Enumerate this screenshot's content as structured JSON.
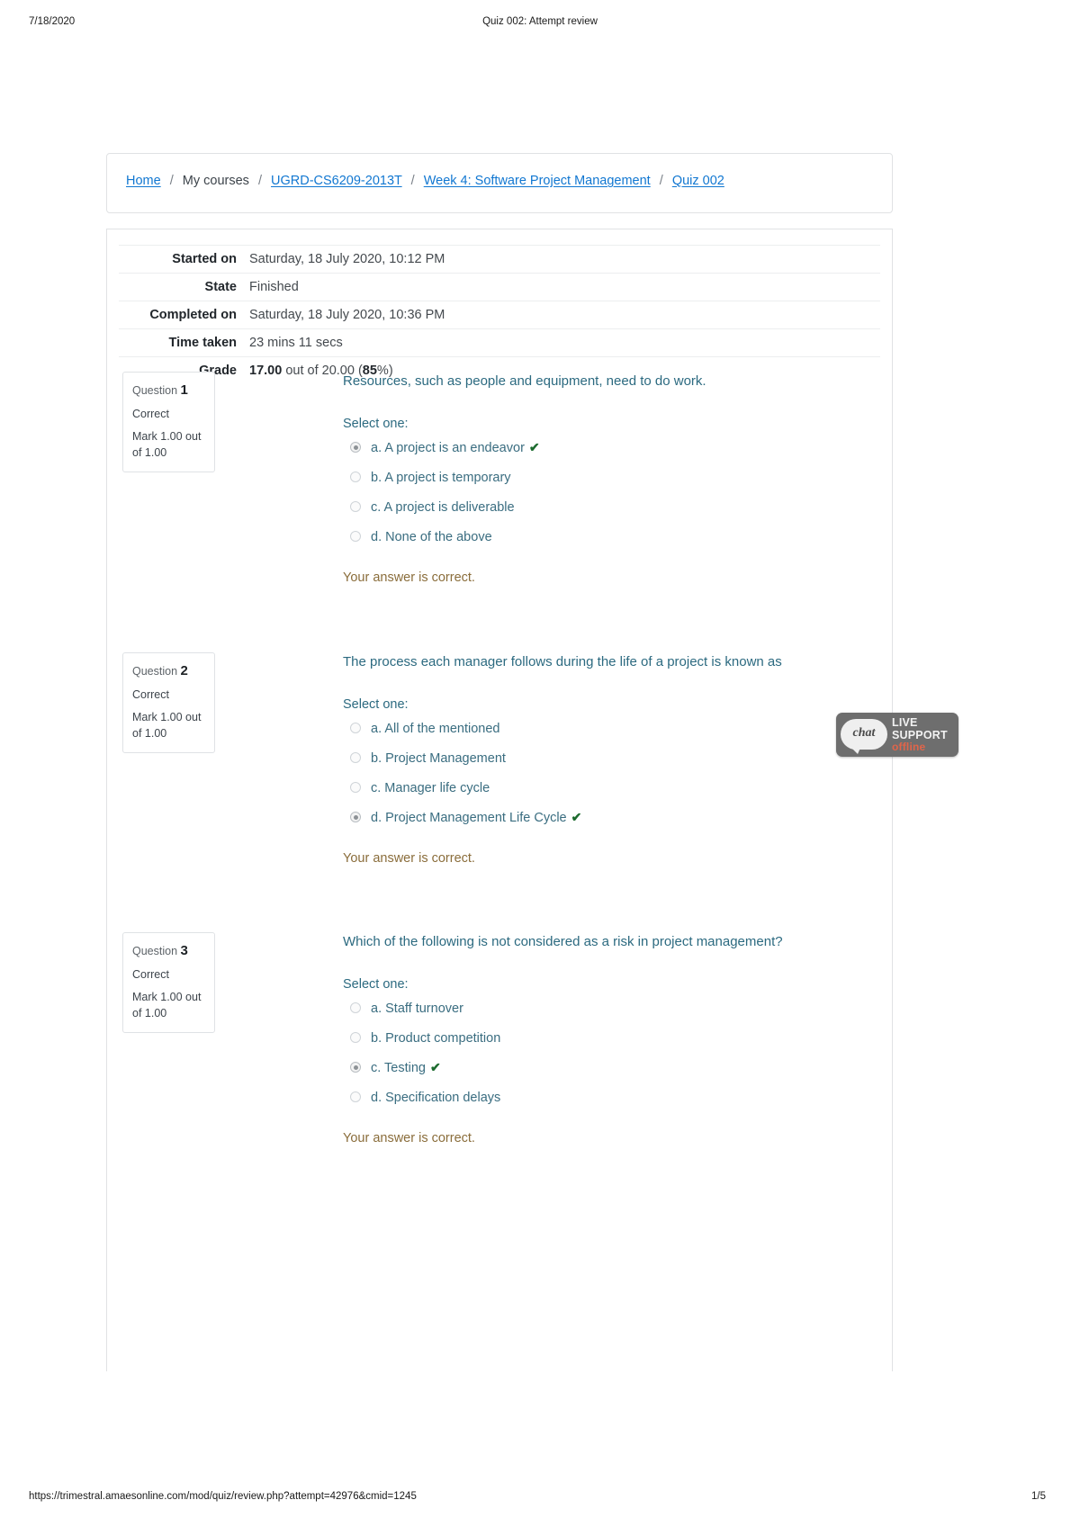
{
  "print": {
    "date": "7/18/2020",
    "title": "Quiz 002: Attempt review",
    "url": "https://trimestral.amaesonline.com/mod/quiz/review.php?attempt=42976&cmid=1245",
    "pagination": "1/5"
  },
  "breadcrumb": {
    "home": "Home",
    "my_courses": "My courses",
    "course": "UGRD-CS6209-2013T",
    "section": "Week 4: Software Project Management",
    "activity": "Quiz 002",
    "separator": "/"
  },
  "summary": {
    "rows": [
      {
        "label": "Started on",
        "value": "Saturday, 18 July 2020, 10:12 PM"
      },
      {
        "label": "State",
        "value": "Finished"
      },
      {
        "label": "Completed on",
        "value": "Saturday, 18 July 2020, 10:36 PM"
      },
      {
        "label": "Time taken",
        "value": "23 mins 11 secs"
      }
    ],
    "grade": {
      "label": "Grade",
      "score": "17.00",
      "middle": " out of 20.00 (",
      "percent": "85",
      "suffix": "%)"
    }
  },
  "common": {
    "question_word": "Question",
    "select_one": "Select one:",
    "correct_feedback": "Your answer is correct.",
    "check_icon": "✔"
  },
  "questions": [
    {
      "number": "1",
      "state": "Correct",
      "mark": "Mark 1.00 out of 1.00",
      "text": "Resources, such as people and equipment, need to do work.",
      "select_one": "Select one:",
      "options": [
        {
          "label": "a. A project is an endeavor",
          "selected": true,
          "correct": true
        },
        {
          "label": "b. A project is temporary",
          "selected": false,
          "correct": false
        },
        {
          "label": "c. A project is deliverable",
          "selected": false,
          "correct": false
        },
        {
          "label": "d. None of the above",
          "selected": false,
          "correct": false
        }
      ],
      "feedback": "Your answer is correct."
    },
    {
      "number": "2",
      "state": "Correct",
      "mark": "Mark 1.00 out of 1.00",
      "text": "The process each manager follows during the life of a project is known as",
      "select_one": "Select one:",
      "options": [
        {
          "label": "a. All of the mentioned",
          "selected": false,
          "correct": false
        },
        {
          "label": "b. Project Management",
          "selected": false,
          "correct": false
        },
        {
          "label": "c. Manager life cycle",
          "selected": false,
          "correct": false
        },
        {
          "label": "d.  Project Management Life Cycle",
          "selected": true,
          "correct": true
        }
      ],
      "feedback": "Your answer is correct."
    },
    {
      "number": "3",
      "state": "Correct",
      "mark": "Mark 1.00 out of 1.00",
      "text": "Which of the following is not considered as a risk in project management?",
      "select_one": "Select one:",
      "options": [
        {
          "label": "a. Staff turnover",
          "selected": false,
          "correct": false
        },
        {
          "label": "b. Product competition",
          "selected": false,
          "correct": false
        },
        {
          "label": "c. Testing",
          "selected": true,
          "correct": true
        },
        {
          "label": "d. Specification delays",
          "selected": false,
          "correct": false
        }
      ],
      "feedback": "Your answer is correct."
    }
  ],
  "chat_widget": {
    "bubble_label": "chat",
    "line1": "LIVE",
    "line2": "SUPPORT",
    "line3": "offline"
  },
  "colors": {
    "link": "#1177d1",
    "question_text": "#2c6a80",
    "answer_text": "#3a6d80",
    "feedback": "#8a6d3b",
    "check": "#1c6b2e",
    "chat_bg": "#6e6e6e",
    "chat_offline": "#e0654a"
  }
}
